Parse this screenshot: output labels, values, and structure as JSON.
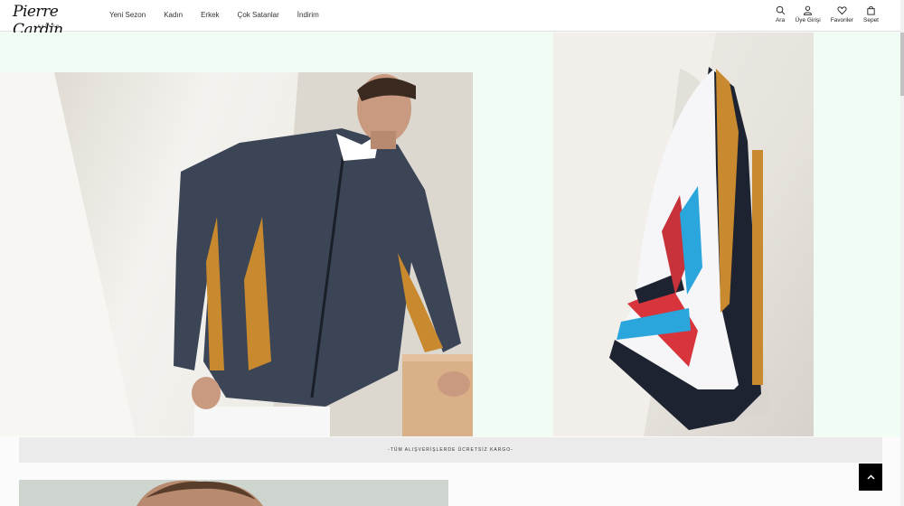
{
  "brand": {
    "name": "Pierre Cardin",
    "sub": "LEATHER"
  },
  "nav": {
    "items": [
      "Yeni Sezon",
      "Kadın",
      "Erkek",
      "Çok Satanlar",
      "İndirim"
    ]
  },
  "tools": {
    "search": "Ara",
    "account": "Üye Girişi",
    "favorites": "Favoriler",
    "cart": "Sepet"
  },
  "banner": {
    "text": "-TÜM ALIŞVERİŞLERDE ÜCRETSİZ KARGO-"
  },
  "colors": {
    "accent": "#000000",
    "hero_bg": "#f1fdf4",
    "jacket": "#3b4556",
    "stripe": "#c98a2f"
  }
}
